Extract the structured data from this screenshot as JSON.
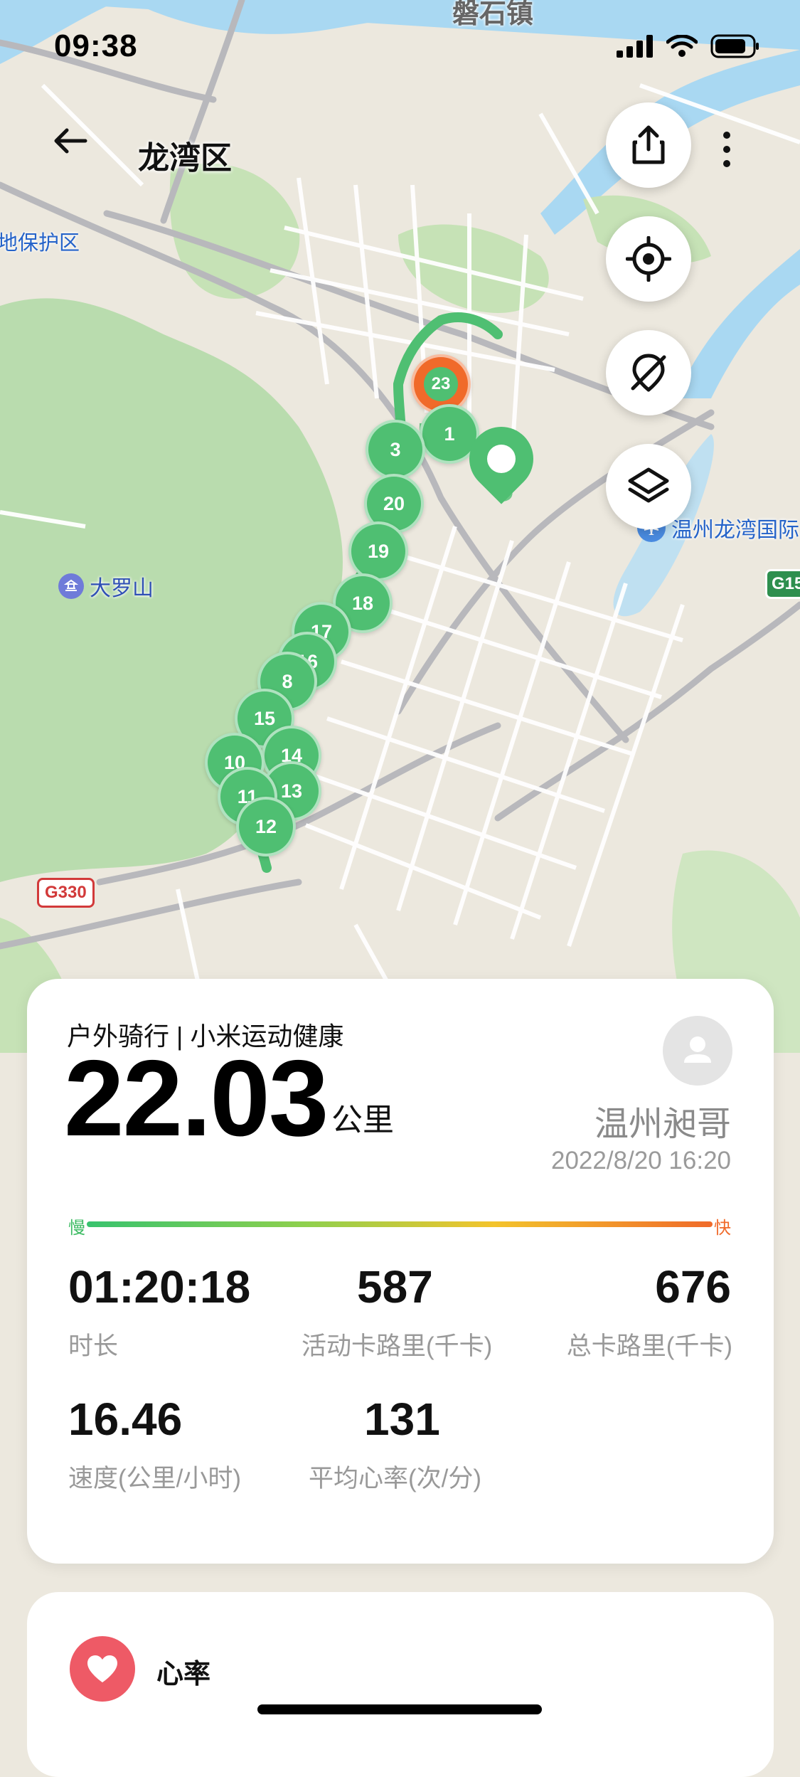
{
  "status_bar": {
    "time": "09:38"
  },
  "header": {
    "district": "龙湾区"
  },
  "map": {
    "labels": {
      "town": "磐石镇",
      "reserve": "地保护区",
      "mountain": "大罗山",
      "airport": "温州龙湾国际",
      "highway_g330": "G330",
      "highway_g15": "G15"
    },
    "markers": [
      "23",
      "1",
      "3",
      "20",
      "19",
      "18",
      "17",
      "16",
      "8",
      "15",
      "14",
      "10",
      "13",
      "11",
      "12"
    ]
  },
  "summary": {
    "activity_type": "户外骑行 | 小米运动健康",
    "distance_value": "22.03",
    "distance_unit": "公里",
    "user_name": "温州昶哥",
    "date": "2022/8/20 16:20",
    "pace_slow": "慢",
    "pace_fast": "快",
    "stats": [
      {
        "value": "01:20:18",
        "label": "时长"
      },
      {
        "value": "587",
        "label": "活动卡路里(千卡)"
      },
      {
        "value": "676",
        "label": "总卡路里(千卡)"
      },
      {
        "value": "16.46",
        "label": "速度(公里/小时)"
      },
      {
        "value": "131",
        "label": "平均心率(次/分)"
      }
    ]
  },
  "heart_rate": {
    "title": "心率"
  },
  "colors": {
    "route": "#4fbf72",
    "end_marker": "#f06a2a",
    "water": "#a9d8f2",
    "park": "#b9dcae"
  }
}
